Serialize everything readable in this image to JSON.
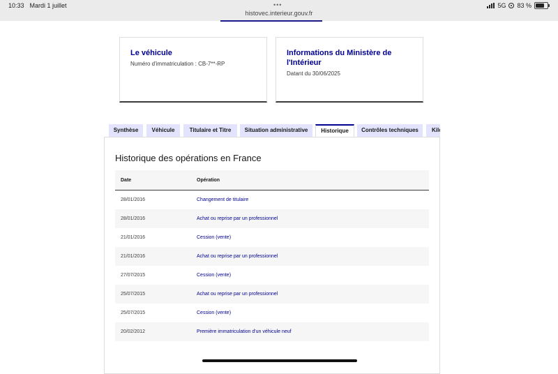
{
  "statusbar": {
    "time": "10:33",
    "date": "Mardi 1 juillet",
    "dots": "•••",
    "url": "histovec.interieur.gouv.fr",
    "network": "5G",
    "battery_percent": "83 %",
    "battery_level": 0.83
  },
  "cards": {
    "vehicle": {
      "title": "Le véhicule",
      "text": "Numéro d'immatriculation : CB-7**-RP"
    },
    "ministry": {
      "title": "Informations du Ministère de l'Intérieur",
      "text": "Datant du 30/06/2025"
    }
  },
  "tabs": [
    {
      "label": "Synthèse"
    },
    {
      "label": "Véhicule"
    },
    {
      "label": "Titulaire et Titre"
    },
    {
      "label": "Situation administrative"
    },
    {
      "label": "Historique",
      "active": true
    },
    {
      "label": "Contrôles techniques"
    },
    {
      "label": "Kilo"
    }
  ],
  "history": {
    "title": "Historique des opérations en France",
    "columns": {
      "date": "Date",
      "operation": "Opération"
    },
    "rows": [
      {
        "date": "28/01/2016",
        "operation": "Changement de titulaire"
      },
      {
        "date": "28/01/2016",
        "operation": "Achat ou reprise par un professionnel"
      },
      {
        "date": "21/01/2016",
        "operation": "Cession (vente)"
      },
      {
        "date": "21/01/2016",
        "operation": "Achat ou reprise par un professionnel"
      },
      {
        "date": "27/07/2015",
        "operation": "Cession (vente)"
      },
      {
        "date": "25/07/2015",
        "operation": "Achat ou reprise par un professionnel"
      },
      {
        "date": "25/07/2015",
        "operation": "Cession (vente)"
      },
      {
        "date": "20/02/2012",
        "operation": "Première immatriculation d'un véhicule neuf"
      }
    ]
  },
  "colors": {
    "accent": "#000091",
    "tab_bg": "#e3e3fd",
    "stripe": "#f6f6f6"
  }
}
